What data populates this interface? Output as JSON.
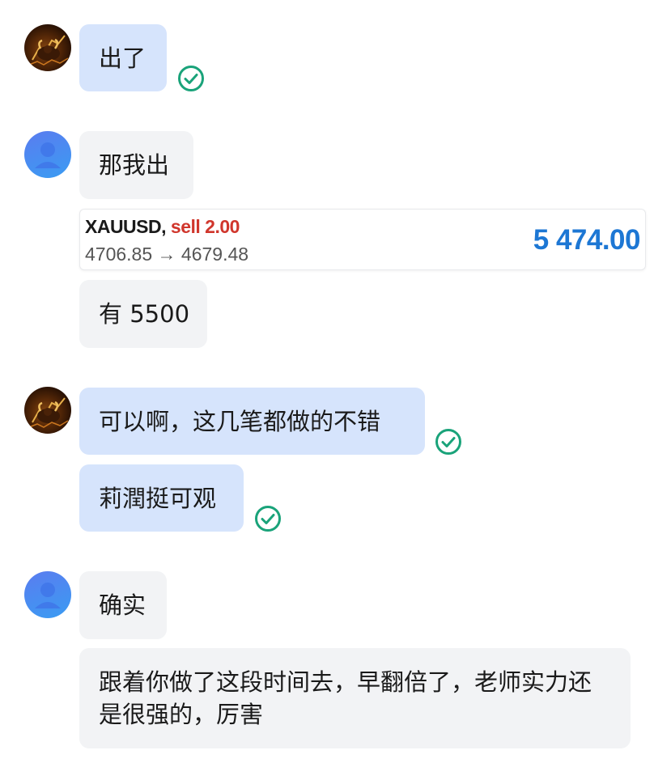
{
  "colors": {
    "sent_bubble": "#d6e4fc",
    "received_bubble": "#f2f3f5",
    "read_check": "#1aa37a",
    "profit_blue": "#1d77d4",
    "sell_red": "#d0362c"
  },
  "messages": [
    {
      "sender": "bull-avatar",
      "text": "出了",
      "read_icon": "double-check-icon"
    },
    {
      "sender": "user-avatar",
      "text": "那我出"
    },
    {
      "sender": "user-avatar",
      "trade": {
        "symbol": "XAUUSD,",
        "side": "sell 2.00",
        "prices": "4706.85 → 4679.48",
        "profit": "5 474.00"
      }
    },
    {
      "sender": "user-avatar",
      "text": "有 5500"
    },
    {
      "sender": "bull-avatar",
      "text": "可以啊，这几笔都做的不错",
      "read_icon": "double-check-icon"
    },
    {
      "sender": "bull-avatar",
      "text": "莉潤挺可观",
      "read_icon": "double-check-icon"
    },
    {
      "sender": "user-avatar",
      "text": "确实"
    },
    {
      "sender": "user-avatar",
      "text": "跟着你做了这段时间去，早翻倍了，老师实力还是很强的，厉害"
    }
  ]
}
